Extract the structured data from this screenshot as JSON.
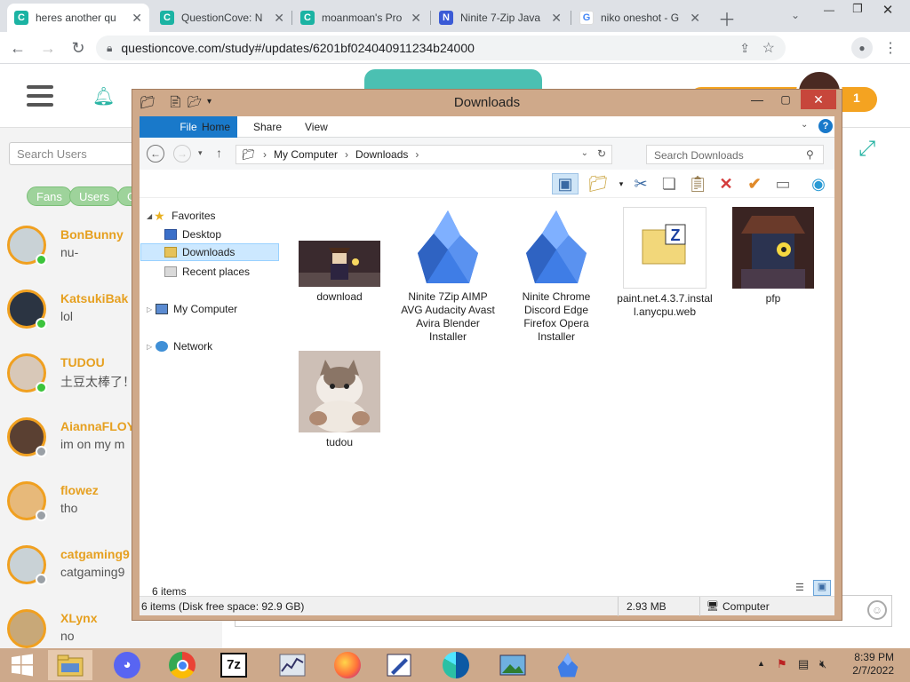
{
  "browser": {
    "tabs": [
      {
        "title": "heres another qu",
        "favicon": "C",
        "color": "#1bb3a3"
      },
      {
        "title": "QuestionCove: N",
        "favicon": "C",
        "color": "#1bb3a3"
      },
      {
        "title": "moanmoan's Pro",
        "favicon": "C",
        "color": "#1bb3a3"
      },
      {
        "title": "Ninite 7-Zip Java",
        "favicon": "N",
        "color": "#3b5bd6"
      },
      {
        "title": "niko oneshot - G",
        "favicon": "G",
        "color": "#4285f4"
      }
    ],
    "url": "questioncove.com/study#/updates/6201bf024040911234b24000"
  },
  "site": {
    "notification_count": "1",
    "search_placeholder": "Search Users",
    "filters": [
      "Fans",
      "Users",
      "G"
    ],
    "users": [
      {
        "name": "BonBunny",
        "msg": "nu-",
        "online": true
      },
      {
        "name": "KatsukiBak",
        "msg": "lol",
        "online": true
      },
      {
        "name": "TUDOU",
        "msg": "土豆太棒了！",
        "online": true
      },
      {
        "name": "AiannaFLOY",
        "msg": "im on my m",
        "online": false
      },
      {
        "name": "flowez",
        "msg": "tho",
        "online": false
      },
      {
        "name": "catgaming9",
        "msg": "catgaming9",
        "online": false
      },
      {
        "name": "XLynx",
        "msg": "no",
        "online": false
      }
    ]
  },
  "explorer": {
    "title": "Downloads",
    "ribbon_tabs": [
      "File",
      "Home",
      "Share",
      "View"
    ],
    "breadcrumb": [
      "My Computer",
      "Downloads"
    ],
    "search_placeholder": "Search Downloads",
    "nav": {
      "favorites": "Favorites",
      "desktop": "Desktop",
      "downloads": "Downloads",
      "recent": "Recent places",
      "computer": "My Computer",
      "network": "Network"
    },
    "files": [
      {
        "name": "download",
        "kind": "image-dark"
      },
      {
        "name": "Ninite 7Zip AIMP AVG Audacity Avast Avira Blender Installer",
        "kind": "ninite"
      },
      {
        "name": "Ninite Chrome Discord Edge Firefox Opera Installer",
        "kind": "ninite"
      },
      {
        "name": "paint.net.4.3.7.install.anycpu.web",
        "kind": "zip"
      },
      {
        "name": "pfp",
        "kind": "image-pfp"
      },
      {
        "name": "tudou",
        "kind": "image-cat"
      }
    ],
    "item_count": "6 items",
    "status_left": "6 items (Disk free space: 92.9 GB)",
    "status_size": "2.93 MB",
    "status_location": "Computer"
  },
  "taskbar": {
    "time": "8:39 PM",
    "date": "2/7/2022"
  }
}
